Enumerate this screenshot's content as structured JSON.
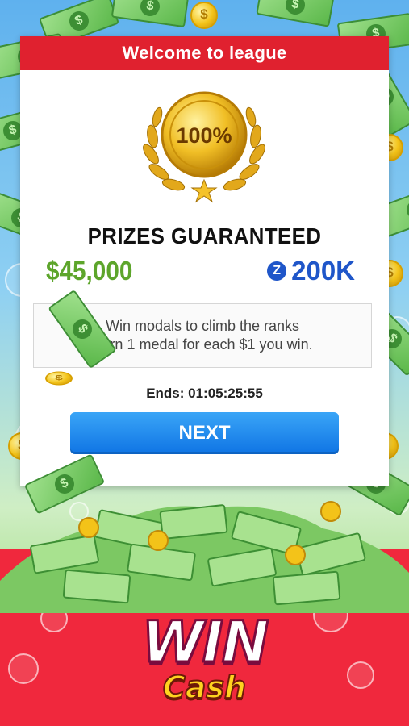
{
  "header": {
    "title": "Welcome to league"
  },
  "medal": {
    "percent": "100%"
  },
  "prizes": {
    "title": "PRIZES GUARANTEED",
    "cash_amount": "$45,000",
    "token_amount": "200K",
    "token_icon": "Z"
  },
  "description": {
    "line1": "Win modals to climb the ranks",
    "line2": "Earn 1 medal for each $1 you win."
  },
  "timer": {
    "text": "Ends: 01:05:25:55"
  },
  "actions": {
    "next_label": "NEXT"
  },
  "brand": {
    "win": "WIN",
    "cash": "Cash"
  },
  "colors": {
    "header_red": "#e0212f",
    "cash_green": "#5da52b",
    "token_blue": "#1f56c9",
    "button_blue": "#1e8df0"
  }
}
